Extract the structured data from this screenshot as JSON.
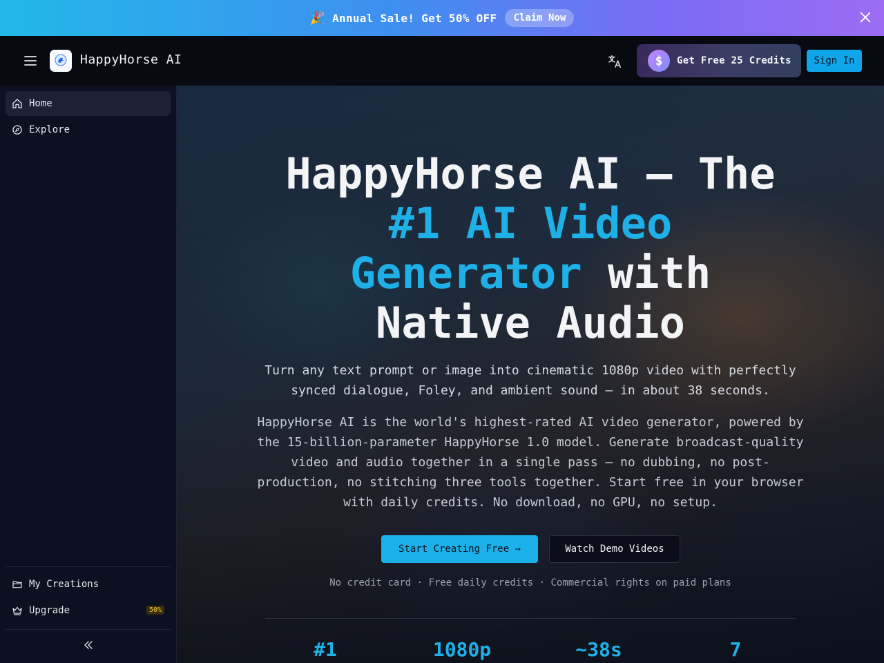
{
  "banner": {
    "emoji": "🎉",
    "text": "Annual Sale! Get 50% OFF",
    "cta": "Claim Now"
  },
  "header": {
    "brand": "HappyHorse AI",
    "credits_label": "Get Free 25 Credits",
    "credits_symbol": "$",
    "signin_label": "Sign In"
  },
  "sidebar": {
    "items": [
      {
        "label": "Home",
        "icon": "home-icon",
        "active": true
      },
      {
        "label": "Explore",
        "icon": "compass-icon",
        "active": false
      }
    ],
    "bottom_items": [
      {
        "label": "My Creations",
        "icon": "folder-icon"
      },
      {
        "label": "Upgrade",
        "icon": "crown-icon",
        "badge": "50%"
      }
    ],
    "collapse_icon": "chevrons-left-icon"
  },
  "hero": {
    "title_part1": "HappyHorse AI — The",
    "title_accent": "#1 AI Video Generator",
    "title_part2": "with Native Audio",
    "subtitle": "Turn any text prompt or image into cinematic 1080p video with perfectly synced dialogue, Foley, and ambient sound — in about 38 seconds.",
    "description": "HappyHorse AI is the world's highest-rated AI video generator, powered by the 15-billion-parameter HappyHorse 1.0 model. Generate broadcast-quality video and audio together in a single pass — no dubbing, no post-production, no stitching three tools together. Start free in your browser with daily credits. No download, no GPU, no setup.",
    "cta_primary": "Start Creating Free →",
    "cta_secondary": "Watch Demo Videos",
    "fineprint": "No credit card · Free daily credits · Commercial rights on paid plans"
  },
  "stats": [
    "#1",
    "1080p",
    "~38s",
    "7"
  ],
  "colors": {
    "accent": "#1fb0e8",
    "signin": "#0ea5e9",
    "sidebar_bg": "#0d1020",
    "header_bg": "#080a12"
  }
}
